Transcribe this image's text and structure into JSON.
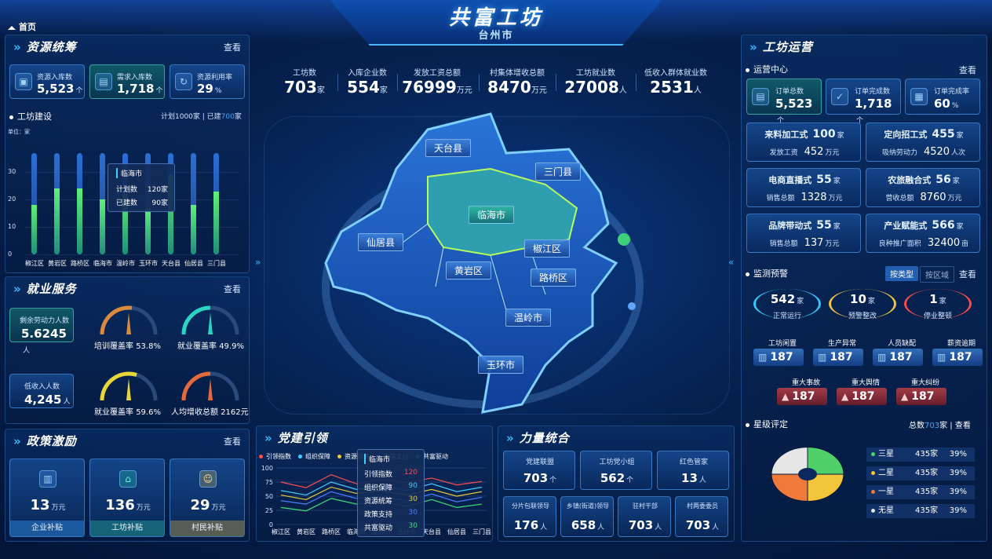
{
  "header": {
    "title": "共富工坊",
    "subtitle": "台州市",
    "home": "首页"
  },
  "kpis": [
    {
      "label": "工坊数",
      "value": "703",
      "unit": "家"
    },
    {
      "label": "入库企业数",
      "value": "554",
      "unit": "家"
    },
    {
      "label": "发放工资总额",
      "value": "76999",
      "unit": "万元"
    },
    {
      "label": "村集体增收总额",
      "value": "8470",
      "unit": "万元"
    },
    {
      "label": "工坊就业数",
      "value": "27008",
      "unit": "人"
    },
    {
      "label": "低收入群体就业数",
      "value": "2531",
      "unit": "人"
    }
  ],
  "resource": {
    "title": "资源统筹",
    "more": "查看",
    "cards": [
      {
        "label": "资源入库数",
        "value": "5,523",
        "unit": "个",
        "icon": "warehouse-icon"
      },
      {
        "label": "需求入库数",
        "value": "1,718",
        "unit": "个",
        "icon": "document-icon"
      },
      {
        "label": "资源利用率",
        "value": "29",
        "unit": "%",
        "icon": "refresh-icon"
      }
    ],
    "build": {
      "title": "工坊建设",
      "plan_text": "计划1000家 | 已建",
      "built": "700",
      "built_unit": "家",
      "unit_label": "单位：家",
      "tooltip": {
        "title": "临海市",
        "rows": [
          {
            "k": "计划数",
            "v": "120家"
          },
          {
            "k": "已建数",
            "v": "90家"
          }
        ]
      }
    }
  },
  "chart_data": {
    "type": "bar",
    "categories": [
      "椒江区",
      "黄岩区",
      "路桥区",
      "临海市",
      "温岭市",
      "玉环市",
      "天台县",
      "仙居县",
      "三门县"
    ],
    "series": [
      {
        "name": "计划数",
        "values": [
          37,
          37,
          37,
          37,
          37,
          37,
          37,
          37,
          37
        ]
      },
      {
        "name": "已建数",
        "values": [
          18,
          24,
          24,
          20,
          22,
          17,
          29,
          18,
          23
        ]
      }
    ],
    "ylim": [
      0,
      40
    ],
    "yticks": [
      0,
      10,
      20,
      30
    ]
  },
  "employment": {
    "title": "就业服务",
    "more": "查看",
    "surplus": {
      "label": "剩余劳动力人数",
      "value": "5.6245",
      "unit": "人"
    },
    "low": {
      "label": "低收入人数",
      "value": "4,245",
      "unit": "人"
    },
    "gauges": [
      {
        "label": "培训覆盖率",
        "value": "53.8",
        "unit": "%",
        "pct": 0.538,
        "color": "#d98a3c"
      },
      {
        "label": "就业覆盖率",
        "value": "49.9",
        "unit": "%",
        "pct": 0.499,
        "color": "#2ad3c2"
      },
      {
        "label": "就业覆盖率",
        "value": "59.6",
        "unit": "%",
        "pct": 0.596,
        "color": "#e8d53a"
      },
      {
        "label": "人均增收总额",
        "value": "2162",
        "unit": "元",
        "pct": 0.5,
        "color": "#e56a3b"
      }
    ]
  },
  "policy": {
    "title": "政策激励",
    "more": "查看",
    "items": [
      {
        "value": "13",
        "unit": "万元",
        "label": "企业补贴",
        "icon": "building-icon"
      },
      {
        "value": "136",
        "unit": "万元",
        "label": "工坊补贴",
        "icon": "house-icon"
      },
      {
        "value": "29",
        "unit": "万元",
        "label": "村民补贴",
        "icon": "person-icon"
      }
    ]
  },
  "party": {
    "title": "党建引领",
    "legend": [
      "引领指数",
      "组织保障",
      "资源统筹",
      "政策支持",
      "共富驱动"
    ],
    "colors": [
      "#ff4d4d",
      "#3fd0ff",
      "#e8c93a",
      "#4d7dff",
      "#3de07a"
    ],
    "yticks": [
      0,
      25,
      50,
      75,
      100
    ],
    "categories": [
      "椒江区",
      "黄岩区",
      "路桥区",
      "临海市",
      "温岭市",
      "玉环市",
      "天台县",
      "仙居县",
      "三门县"
    ],
    "series": [
      [
        75,
        65,
        88,
        72,
        80,
        74,
        82,
        70,
        76
      ],
      [
        60,
        52,
        75,
        62,
        68,
        60,
        72,
        58,
        66
      ],
      [
        52,
        44,
        66,
        55,
        60,
        52,
        62,
        50,
        58
      ],
      [
        42,
        36,
        58,
        46,
        50,
        42,
        54,
        40,
        48
      ],
      [
        30,
        24,
        46,
        36,
        40,
        32,
        44,
        30,
        36
      ]
    ],
    "tooltip": {
      "title": "临海市",
      "rows": [
        {
          "k": "引领指数",
          "v": "120"
        },
        {
          "k": "组织保障",
          "v": "90"
        },
        {
          "k": "资源统筹",
          "v": "30"
        },
        {
          "k": "政策支持",
          "v": "30"
        },
        {
          "k": "共富驱动",
          "v": "30"
        }
      ]
    }
  },
  "force": {
    "title": "力量统合",
    "row1": [
      {
        "label": "党建联盟",
        "value": "703",
        "unit": "个"
      },
      {
        "label": "工坊党小组",
        "value": "562",
        "unit": "个"
      },
      {
        "label": "红色管家",
        "value": "13",
        "unit": "人"
      }
    ],
    "row2": [
      {
        "label": "分片包联领导",
        "value": "176",
        "unit": "人"
      },
      {
        "label": "乡镇(街道)领导",
        "value": "658",
        "unit": "人"
      },
      {
        "label": "驻村干部",
        "value": "703",
        "unit": "人"
      },
      {
        "label": "村两委委员",
        "value": "703",
        "unit": "人"
      }
    ]
  },
  "map": {
    "labels": [
      {
        "name": "天台县",
        "hl": false
      },
      {
        "name": "三门县",
        "hl": false
      },
      {
        "name": "临海市",
        "hl": true
      },
      {
        "name": "仙居县",
        "hl": false
      },
      {
        "name": "椒江区",
        "hl": false
      },
      {
        "name": "黄岩区",
        "hl": false
      },
      {
        "name": "路桥区",
        "hl": false
      },
      {
        "name": "温岭市",
        "hl": false
      },
      {
        "name": "玉环市",
        "hl": false
      }
    ]
  },
  "ops": {
    "title": "工坊运营",
    "center": {
      "title": "运营中心",
      "more": "查看"
    },
    "orders": [
      {
        "label": "订单总数",
        "value": "5,523",
        "unit": "个",
        "icon": "document-icon"
      },
      {
        "label": "订单完成数",
        "value": "1,718",
        "unit": "个",
        "icon": "check-icon"
      },
      {
        "label": "订单完成率",
        "value": "60",
        "unit": "%",
        "icon": "clipboard-icon"
      }
    ],
    "modes": [
      {
        "name": "来料加工式",
        "count": "100",
        "cunit": "家",
        "sub": "发放工资",
        "subv": "452",
        "subu": "万元"
      },
      {
        "name": "定向招工式",
        "count": "455",
        "cunit": "家",
        "sub": "吸纳劳动力",
        "subv": "4520",
        "subu": "人次"
      },
      {
        "name": "电商直播式",
        "count": "55",
        "cunit": "家",
        "sub": "销售总额",
        "subv": "1328",
        "subu": "万元"
      },
      {
        "name": "农旅融合式",
        "count": "56",
        "cunit": "家",
        "sub": "营收总额",
        "subv": "8760",
        "subu": "万元"
      },
      {
        "name": "品牌带动式",
        "count": "55",
        "cunit": "家",
        "sub": "销售总额",
        "subv": "137",
        "subu": "万元"
      },
      {
        "name": "产业赋能式",
        "count": "566",
        "cunit": "家",
        "sub": "良种推广面积",
        "subv": "32400",
        "subu": "亩"
      }
    ]
  },
  "monitor": {
    "title": "监测预警",
    "tab1": "按类型",
    "tab2": "按区域",
    "more": "查看",
    "status": [
      {
        "value": "542",
        "unit": "家",
        "label": "正常运行",
        "color": "#32c8ff"
      },
      {
        "value": "10",
        "unit": "家",
        "label": "预警整改",
        "color": "#f2c53a"
      },
      {
        "value": "1",
        "unit": "家",
        "label": "停业整顿",
        "color": "#ff4a4a"
      }
    ],
    "row1": [
      {
        "label": "工坊闲置",
        "value": "187"
      },
      {
        "label": "生产异常",
        "value": "187"
      },
      {
        "label": "人员缺配",
        "value": "187"
      },
      {
        "label": "薪资逾期",
        "value": "187"
      }
    ],
    "row2": [
      {
        "label": "重大事故",
        "value": "187"
      },
      {
        "label": "重大舆情",
        "value": "187"
      },
      {
        "label": "重大纠纷",
        "value": "187"
      }
    ]
  },
  "stars": {
    "title": "星级评定",
    "total_prefix": "总数",
    "total": "703",
    "total_unit": "家",
    "more": "查看",
    "rows": [
      {
        "name": "三星",
        "count": "435家",
        "pct": "39%",
        "color": "#4fd06b"
      },
      {
        "name": "二星",
        "count": "435家",
        "pct": "39%",
        "color": "#f2c53a"
      },
      {
        "name": "一星",
        "count": "435家",
        "pct": "39%",
        "color": "#f07a3a"
      },
      {
        "name": "无星",
        "count": "435家",
        "pct": "39%",
        "color": "#e6e6e6"
      }
    ]
  }
}
